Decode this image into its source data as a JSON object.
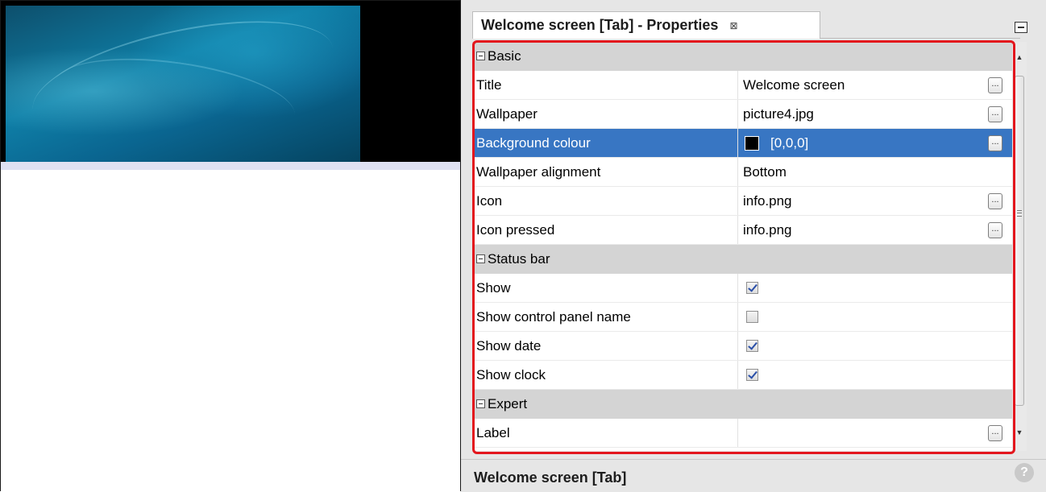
{
  "panel": {
    "tab_title": "Welcome screen [Tab] - Properties",
    "close_glyph": "⊠",
    "footer_title": "Welcome screen [Tab]",
    "help_glyph": "?",
    "ellipsis": "...",
    "scroll_up": "▲",
    "scroll_down": "▼"
  },
  "categories": {
    "basic": "Basic",
    "status_bar": "Status bar",
    "expert": "Expert"
  },
  "basic": {
    "title": {
      "name": "Title",
      "value": "Welcome screen"
    },
    "wallpaper": {
      "name": "Wallpaper",
      "value": "picture4.jpg"
    },
    "background_colour": {
      "name": "Background colour",
      "value": "[0,0,0]",
      "color": "#000000"
    },
    "wallpaper_alignment": {
      "name": "Wallpaper alignment",
      "value": "Bottom"
    },
    "icon": {
      "name": "Icon",
      "value": "info.png"
    },
    "icon_pressed": {
      "name": "Icon pressed",
      "value": "info.png"
    }
  },
  "status_bar": {
    "show": {
      "name": "Show",
      "checked": true
    },
    "show_control_panel_name": {
      "name": "Show control panel name",
      "checked": false
    },
    "show_date": {
      "name": "Show date",
      "checked": true
    },
    "show_clock": {
      "name": "Show clock",
      "checked": true
    }
  },
  "expert": {
    "label": {
      "name": "Label",
      "value": ""
    }
  },
  "colors": {
    "selection": "#3876c3",
    "highlight_border": "#e3161d",
    "category_bg": "#d4d4d4"
  }
}
